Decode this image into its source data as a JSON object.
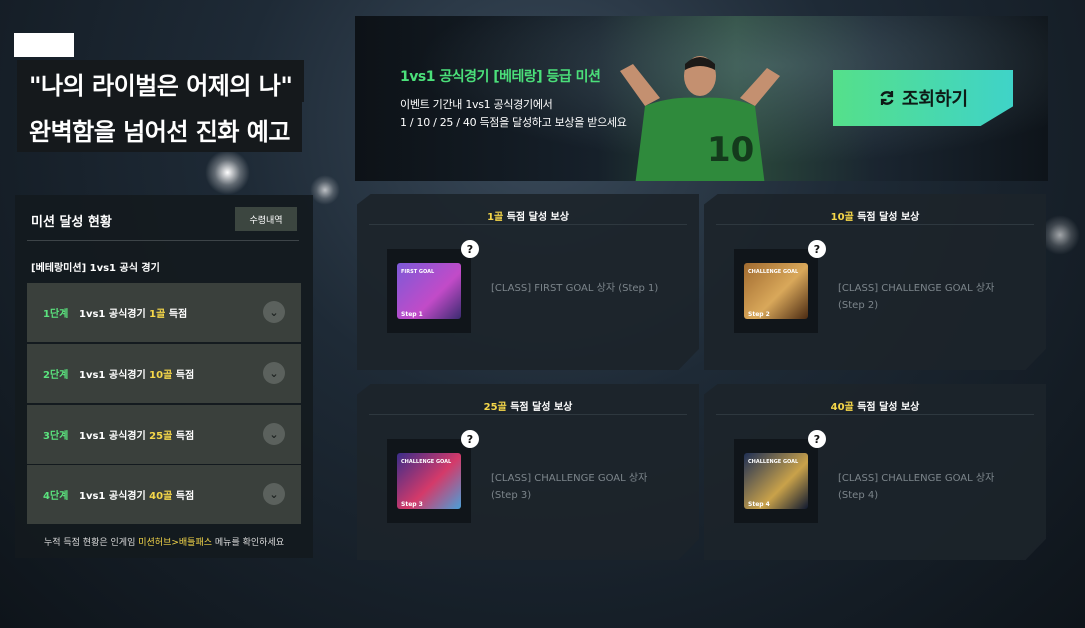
{
  "header": {
    "title_line1": "\"나의 라이벌은 어제의 나\"",
    "title_line2": "완벽함을 넘어선 진화 예고"
  },
  "banner": {
    "title": "1vs1 공식경기 [베테랑] 등급 미션",
    "desc_line1": "이벤트 기간내 1vs1 공식경기에서",
    "desc_line2": "1 / 10 / 25 / 40 득점을 달성하고 보상을 받으세요",
    "button_label": "조회하기",
    "jersey_number": "10"
  },
  "mission_panel": {
    "title": "미션 달성 현황",
    "history_button": "수령내역",
    "subtitle": "[베테랑미션] 1vs1 공식 경기",
    "stages": [
      {
        "level": "1단계",
        "prefix": "1vs1 공식경기",
        "goal": "1골",
        "suffix": "득점"
      },
      {
        "level": "2단계",
        "prefix": "1vs1 공식경기",
        "goal": "10골",
        "suffix": "득점"
      },
      {
        "level": "3단계",
        "prefix": "1vs1 공식경기",
        "goal": "25골",
        "suffix": "득점"
      },
      {
        "level": "4단계",
        "prefix": "1vs1 공식경기",
        "goal": "40골",
        "suffix": "득점"
      }
    ],
    "note_prefix": "누적 득점 현황은 인게임",
    "note_highlight": "미션허브>배틀패스",
    "note_suffix": "메뉴를 확인하세요"
  },
  "rewards": [
    {
      "goal": "1골",
      "head_suffix": "득점 달성 보상",
      "item_line1": "[CLASS] FIRST GOAL 상자 (Step 1)",
      "item_line2": "",
      "chest_label": "FIRST GOAL",
      "chest_step": "Step 1",
      "chest_color": "#5a3fa8"
    },
    {
      "goal": "10골",
      "head_suffix": "득점 달성 보상",
      "item_line1": "[CLASS] CHALLENGE GOAL 상자",
      "item_line2": "(Step 2)",
      "chest_label": "CHALLENGE GOAL",
      "chest_step": "Step 2",
      "chest_color": "#7a4a22"
    },
    {
      "goal": "25골",
      "head_suffix": "득점 달성 보상",
      "item_line1": "[CLASS] CHALLENGE GOAL 상자",
      "item_line2": "(Step 3)",
      "chest_label": "CHALLENGE GOAL",
      "chest_step": "Step 3",
      "chest_color": "#3a2d8a"
    },
    {
      "goal": "40골",
      "head_suffix": "득점 달성 보상",
      "item_line1": "[CLASS] CHALLENGE GOAL 상자",
      "item_line2": "(Step 4)",
      "chest_label": "CHALLENGE GOAL",
      "chest_step": "Step 4",
      "chest_color": "#1e2f55"
    }
  ],
  "help_icon": "?",
  "colors": {
    "accent_green": "#5be37e",
    "highlight_yellow": "#f5d74a",
    "button_gradient_start": "#55e08a",
    "button_gradient_end": "#3fd3c8"
  }
}
